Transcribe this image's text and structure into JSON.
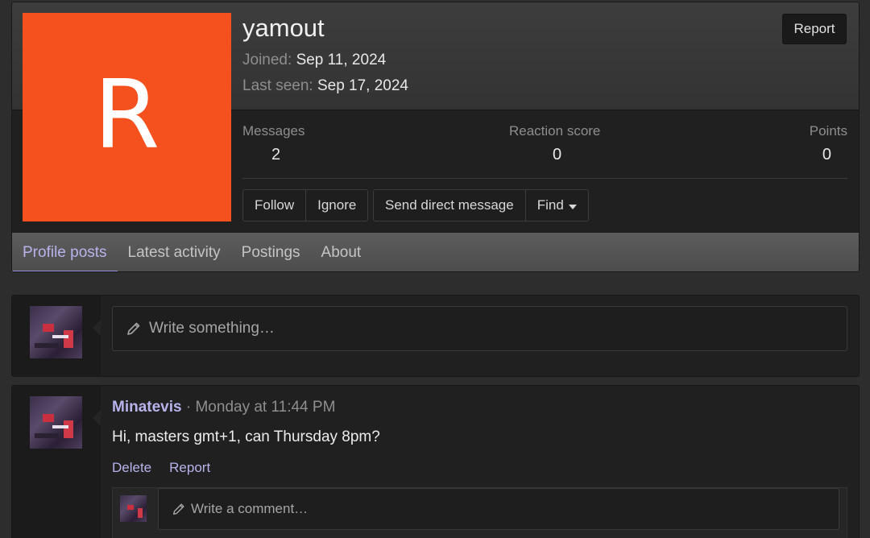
{
  "profile": {
    "avatar_letter": "R",
    "avatar_color": "#f4511e",
    "username": "yamout",
    "joined_label": "Joined:",
    "joined_value": "Sep 11, 2024",
    "last_seen_label": "Last seen:",
    "last_seen_value": "Sep 17, 2024",
    "report_label": "Report"
  },
  "stats": {
    "messages_label": "Messages",
    "messages_value": "2",
    "reaction_label": "Reaction score",
    "reaction_value": "0",
    "points_label": "Points",
    "points_value": "0"
  },
  "actions": {
    "follow": "Follow",
    "ignore": "Ignore",
    "send_dm": "Send direct message",
    "find": "Find"
  },
  "tabs": [
    {
      "label": "Profile posts",
      "active": true
    },
    {
      "label": "Latest activity",
      "active": false
    },
    {
      "label": "Postings",
      "active": false
    },
    {
      "label": "About",
      "active": false
    }
  ],
  "composer": {
    "placeholder": "Write something…"
  },
  "post": {
    "author": "Minatevis",
    "separator": " · ",
    "time": "Monday at 11:44 PM",
    "text": "Hi, masters gmt+1, can Thursday 8pm?",
    "delete_label": "Delete",
    "report_label": "Report",
    "comment_placeholder": "Write a comment…"
  },
  "colors": {
    "accent": "#b7b3ec",
    "tab_underline": "#9a93e0",
    "background": "#2d2d2d"
  }
}
